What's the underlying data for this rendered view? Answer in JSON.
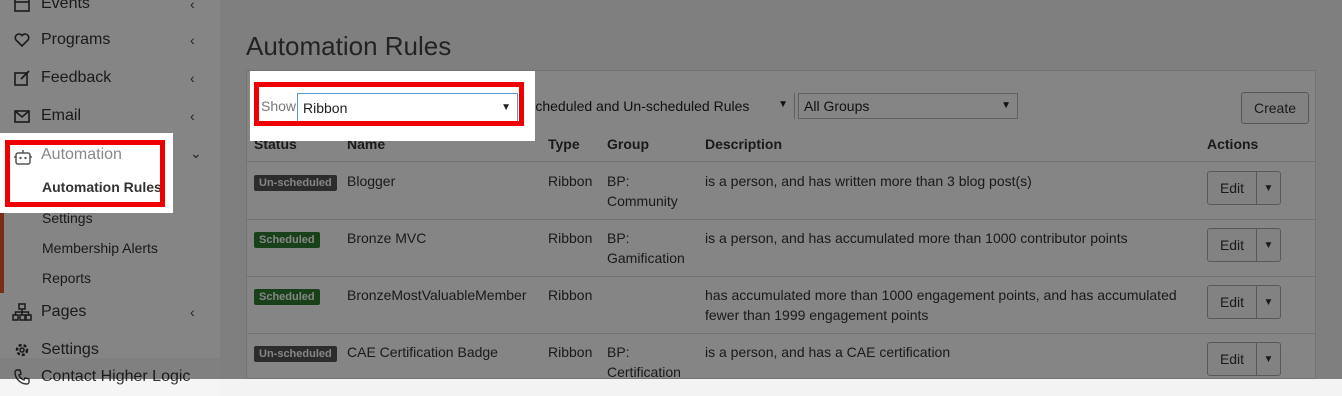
{
  "sidebar": {
    "items": [
      {
        "label": "Events",
        "icon": "calendar-icon"
      },
      {
        "label": "Programs",
        "icon": "heart-icon"
      },
      {
        "label": "Feedback",
        "icon": "edit-icon"
      },
      {
        "label": "Email",
        "icon": "envelope-icon"
      },
      {
        "label": "Automation",
        "icon": "robot-icon"
      },
      {
        "label": "Pages",
        "icon": "sitemap-icon"
      },
      {
        "label": "Settings",
        "icon": "gear-icon"
      },
      {
        "label": "Contact Higher Logic",
        "icon": "phone-icon"
      }
    ],
    "automation_sub": [
      "Automation Rules",
      "Settings",
      "Membership Alerts",
      "Reports"
    ]
  },
  "page": {
    "title": "Automation Rules"
  },
  "filters": {
    "show_label": "Show",
    "type_value": "Ribbon",
    "schedule_value": "Scheduled and Un-scheduled Rules",
    "group_value": "All Groups",
    "create_label": "Create"
  },
  "table": {
    "headers": [
      "Status",
      "Name",
      "Type",
      "Group",
      "Description",
      "Actions"
    ],
    "rows": [
      {
        "status": "Un-scheduled",
        "name": "Blogger",
        "type": "Ribbon",
        "group_line1": "BP:",
        "group_line2": "Community",
        "desc_line1": "is a person, and has written more than 3 blog post(s)",
        "desc_line2": ""
      },
      {
        "status": "Scheduled",
        "name": "Bronze MVC",
        "type": "Ribbon",
        "group_line1": "BP:",
        "group_line2": "Gamification",
        "desc_line1": "is a person, and has accumulated more than 1000 contributor points",
        "desc_line2": ""
      },
      {
        "status": "Scheduled",
        "name": "BronzeMostValuableMember",
        "type": "Ribbon",
        "group_line1": "",
        "group_line2": "",
        "desc_line1": "has accumulated more than 1000 engagement points, and has accumulated",
        "desc_line2": "fewer than 1999 engagement points"
      },
      {
        "status": "Un-scheduled",
        "name": "CAE Certification Badge",
        "type": "Ribbon",
        "group_line1": "BP:",
        "group_line2": "Certification",
        "desc_line1": "is a person, and has a CAE certification",
        "desc_line2": ""
      }
    ],
    "edit_label": "Edit"
  },
  "colors": {
    "highlight_frame": "#e00000",
    "scheduled_badge": "#2e7d32",
    "unscheduled_badge": "#555555"
  }
}
